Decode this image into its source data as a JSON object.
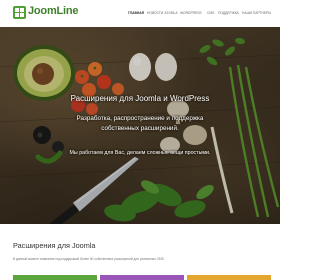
{
  "brand": {
    "logo_text": "JoomLine"
  },
  "nav": {
    "items": [
      {
        "label": "ГЛАВНАЯ",
        "active": true
      },
      {
        "label": "НОВОСТИ"
      },
      {
        "label": "JOOMLA"
      },
      {
        "label": "WORDPRESS"
      },
      {
        "label": "CMS"
      },
      {
        "label": "ПОДДЕРЖКА"
      },
      {
        "label": "НАШИ ПАРТНЕРЫ"
      }
    ]
  },
  "hero": {
    "title": "Расширения для Joomla и WordPress",
    "subtitle": "Разработка, распространение и поддержка собственных расширений.",
    "tagline": "Мы работаем для Вас, делаем сложные вещи простыми."
  },
  "extensions": {
    "title": "Расширения для Joomla",
    "description": "В данный момент компания под поддержкой более 50 собственных расширений для различных CMS.",
    "card_colors": [
      "#5ba53d",
      "#9a55b8",
      "#e4a62c"
    ]
  },
  "colors": {
    "brand_green": "#4fa336",
    "logo_text": "#3d7f2b"
  }
}
